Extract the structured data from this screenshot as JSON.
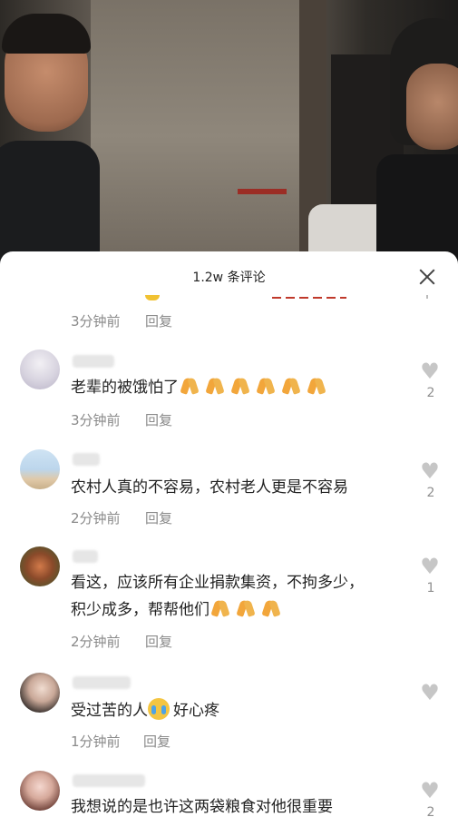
{
  "sheet": {
    "comment_count": "1.2w 条评论"
  },
  "partial_comment": {
    "time": "3分钟前",
    "reply": "回复"
  },
  "comments": [
    {
      "text": "老辈的被饿怕了",
      "emojis": [
        "pray-emoji",
        "pray-emoji",
        "pray-emoji",
        "pray-emoji",
        "pray-emoji",
        "pray-emoji"
      ],
      "time": "3分钟前",
      "reply": "回复",
      "likes": "2"
    },
    {
      "text": "农村人真的不容易，农村老人更是不容易",
      "time": "2分钟前",
      "reply": "回复",
      "likes": "2"
    },
    {
      "text_line1": "看这，应该所有企业捐款集资，不拘多少，",
      "text_line2": "积少成多，帮帮他们",
      "emojis": [
        "pray-emoji",
        "pray-emoji",
        "pray-emoji"
      ],
      "time": "2分钟前",
      "reply": "回复",
      "likes": "1"
    },
    {
      "text_before": "受过苦的人",
      "emoji": "crying-emoji",
      "text_after": "好心疼",
      "time": "1分钟前",
      "reply": "回复"
    },
    {
      "text": "我想说的是也许这两袋粮食对他很重要",
      "likes": "2"
    }
  ],
  "icons": {
    "heart": "heart-icon",
    "close": "close-icon"
  },
  "colors": {
    "heart": "#c6c6c6",
    "meta_text": "#8a8a8a",
    "body_text": "#222222"
  }
}
